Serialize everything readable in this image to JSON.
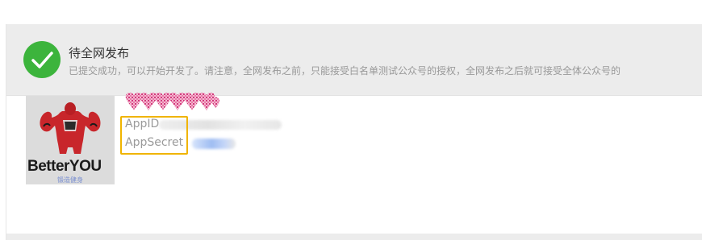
{
  "status": {
    "title": "待全网发布",
    "description": "已提交成功，可以开始开发了。请注意，全网发布之前，只能接受白名单测试公众号的授权，全网发布之后就可接受全体公众号的",
    "icon": "check-circle-icon",
    "icon_color": "#3cb43c"
  },
  "app": {
    "logo": {
      "icon": "bodybuilder-logo-icon",
      "brand_text": "BetterYOU",
      "brand_subtext": "锻造健身"
    },
    "credentials": {
      "appid_label": "AppID",
      "appsecret_label": "AppSecret"
    },
    "highlight_color": "#f0b400"
  }
}
